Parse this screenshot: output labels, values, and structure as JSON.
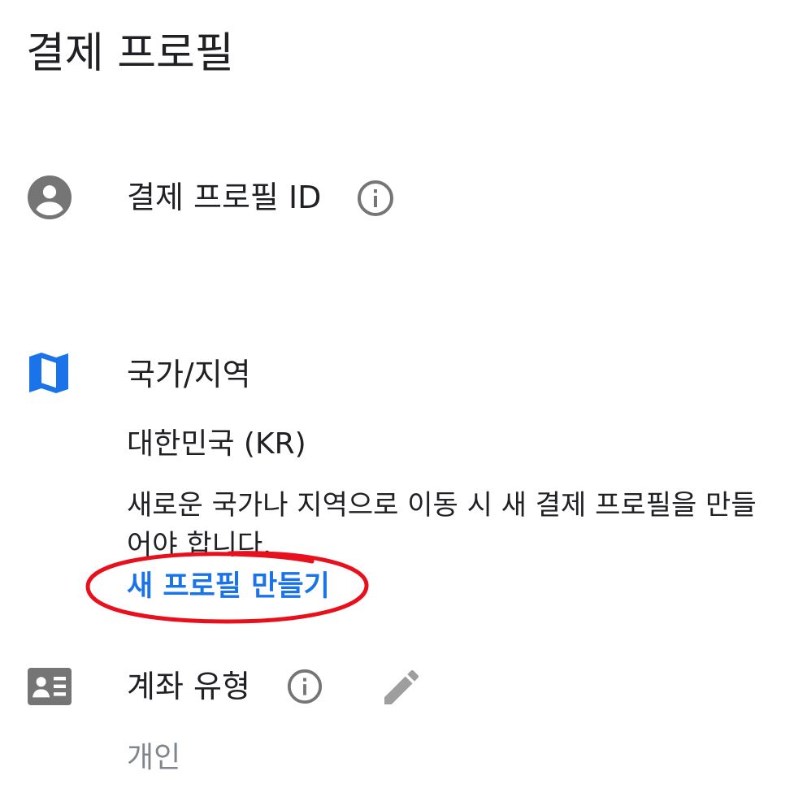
{
  "header": {
    "title": "결제 프로필"
  },
  "profile_id": {
    "icon": "account-circle-icon",
    "label": "결제 프로필 ID",
    "info_icon": "info-icon"
  },
  "country": {
    "icon": "map-icon",
    "label": "국가/지역",
    "value": "대한민국 (KR)",
    "description": "새로운 국가나 지역으로 이동 시 새 결제 프로필을 만들어야 합니다.",
    "link_label": "새 프로필 만들기"
  },
  "account_type": {
    "icon": "contact-card-icon",
    "label": "계좌 유형",
    "info_icon": "info-icon",
    "edit_icon": "edit-pencil-icon",
    "value": "개인"
  },
  "colors": {
    "icon_gray": "#757575",
    "map_blue": "#1a73e8",
    "link_blue": "#1a73e8",
    "annotation_red": "#e8101c"
  }
}
